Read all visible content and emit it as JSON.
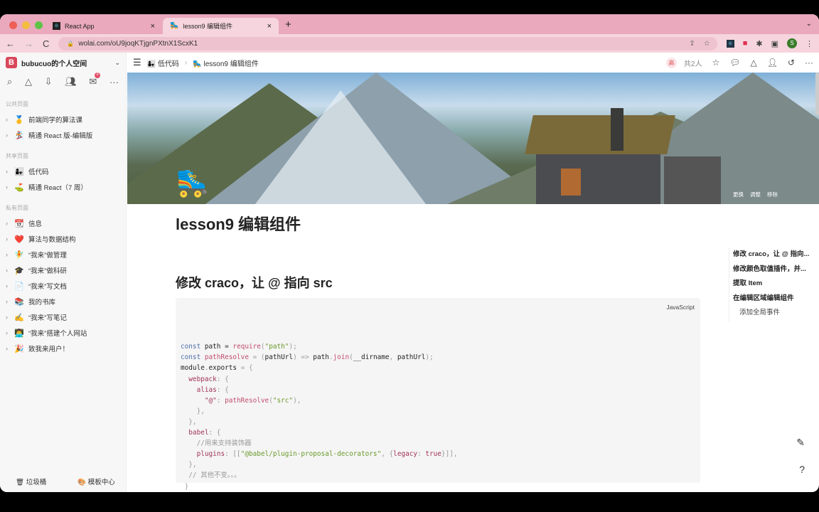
{
  "browser": {
    "tabs": [
      {
        "title": "React App",
        "icon": "react-icon"
      },
      {
        "title": "lesson9 编辑组件",
        "icon": "roller-skate-icon"
      }
    ],
    "url": "wolai.com/oU9joqKTjgnPXtnX1ScxK1",
    "profile_initial": "S"
  },
  "sidebar": {
    "workspace": "bubucuo的个人空间",
    "workspace_initial": "B",
    "inbox_count": "6",
    "sections": [
      {
        "title": "公共页面",
        "items": [
          {
            "emoji": "🥇",
            "label": "前端同学的算法课"
          },
          {
            "emoji": "🏂",
            "label": "精通 React 版-编辑版"
          }
        ]
      },
      {
        "title": "共享页面",
        "items": [
          {
            "emoji": "👩‍👧",
            "label": "低代码"
          },
          {
            "emoji": "⛳",
            "label": "精通 React（7 周）"
          }
        ]
      },
      {
        "title": "私有页面",
        "items": [
          {
            "emoji": "📆",
            "label": "信息"
          },
          {
            "emoji": "❤️",
            "label": "算法与数据结构"
          },
          {
            "emoji": "🧚",
            "label": "“我来”做管理"
          },
          {
            "emoji": "🎓",
            "label": "“我来”做科研"
          },
          {
            "emoji": "📄",
            "label": "“我来”写文档"
          },
          {
            "emoji": "📚",
            "label": "我的书库"
          },
          {
            "emoji": "✍️",
            "label": "“我来”写笔记"
          },
          {
            "emoji": "👨‍💻",
            "label": "“我来”搭建个人网站"
          },
          {
            "emoji": "🎉",
            "label": "致我来用户！"
          }
        ]
      }
    ],
    "trash": "垃圾桶",
    "templates": "模板中心"
  },
  "topbar": {
    "breadcrumb": [
      "低代码",
      "lesson9 编辑组件"
    ],
    "collab_avatar": "高",
    "collab_count": "共2人"
  },
  "cover": {
    "buttons": [
      "更换",
      "调整",
      "移除"
    ]
  },
  "page": {
    "title": "lesson9 编辑组件",
    "heading": "修改 craco，让 @ 指向 src",
    "code_lang": "JavaScript",
    "code": [
      [
        [
          "const ",
          "k"
        ],
        [
          "path = ",
          "p"
        ],
        [
          "require",
          "f"
        ],
        [
          "(",
          "o"
        ],
        [
          "\"path\"",
          "s"
        ],
        [
          ");",
          "o"
        ]
      ],
      [
        [
          "const ",
          "k"
        ],
        [
          "pathResolve",
          "f"
        ],
        [
          " = (",
          "o"
        ],
        [
          "pathUrl",
          "p"
        ],
        [
          ") => ",
          "o"
        ],
        [
          "path",
          "p"
        ],
        [
          ".",
          "o"
        ],
        [
          "join",
          "f"
        ],
        [
          "(",
          "o"
        ],
        [
          "__dirname",
          "p"
        ],
        [
          ", ",
          "o"
        ],
        [
          "pathUrl",
          "p"
        ],
        [
          ");",
          "o"
        ]
      ],
      [
        [
          "module",
          "p"
        ],
        [
          ".",
          "o"
        ],
        [
          "exports",
          "p"
        ],
        [
          " = {",
          "o"
        ]
      ],
      [
        [
          "  webpack",
          "pr"
        ],
        [
          ": {",
          "o"
        ]
      ],
      [
        [
          "    alias",
          "pr"
        ],
        [
          ": {",
          "o"
        ]
      ],
      [
        [
          "      \"@\"",
          "pr"
        ],
        [
          ": ",
          "o"
        ],
        [
          "pathResolve",
          "f"
        ],
        [
          "(",
          "o"
        ],
        [
          "\"src\"",
          "s"
        ],
        [
          "),",
          "o"
        ]
      ],
      [
        [
          "    },",
          "o"
        ]
      ],
      [
        [
          "  },",
          "o"
        ]
      ],
      [
        [
          "  babel",
          "pr"
        ],
        [
          ": {",
          "o"
        ]
      ],
      [
        [
          "    //用来支持装饰器",
          "c"
        ]
      ],
      [
        [
          "    plugins",
          "pr"
        ],
        [
          ": [[",
          "o"
        ],
        [
          "\"@babel/plugin-proposal-decorators\"",
          "s"
        ],
        [
          ", {",
          "o"
        ],
        [
          "legacy",
          "pr"
        ],
        [
          ": ",
          "o"
        ],
        [
          "true",
          "pr"
        ],
        [
          "}]],",
          "o"
        ]
      ],
      [
        [
          "  },",
          "o"
        ]
      ],
      [
        [
          "  // 其他不变。。。",
          "c"
        ]
      ],
      [
        [
          " }",
          "o"
        ]
      ]
    ]
  },
  "toc": [
    {
      "label": "修改 craco，让 @ 指向...",
      "level": 1
    },
    {
      "label": "修改颜色取值插件，并...",
      "level": 1
    },
    {
      "label": "提取 Item",
      "level": 1
    },
    {
      "label": "在编辑区域编辑组件",
      "level": 1
    },
    {
      "label": "添加全局事件",
      "level": 2
    }
  ]
}
